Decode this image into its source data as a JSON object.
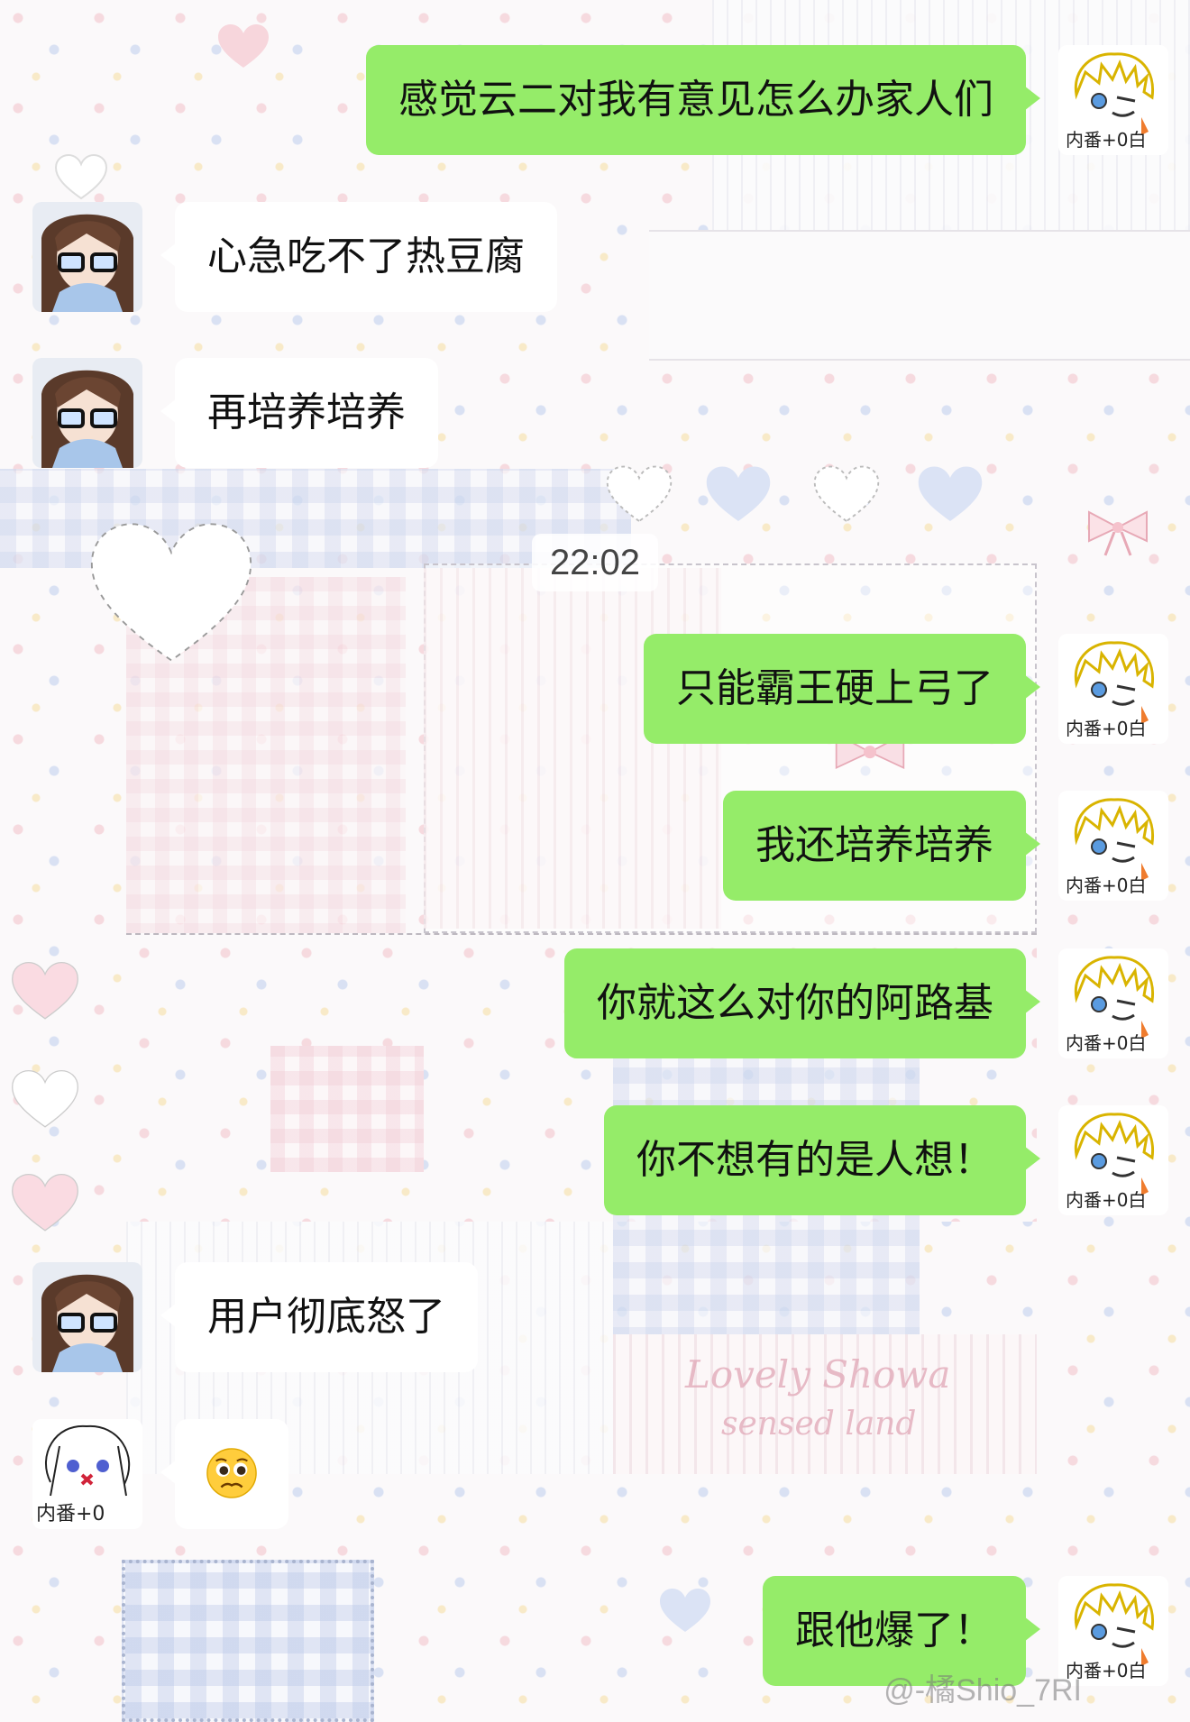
{
  "chat": {
    "timestamp": "22:02",
    "messages": [
      {
        "side": "out",
        "text": "感觉云二对我有意见怎么办家人们"
      },
      {
        "side": "in",
        "text": "心急吃不了热豆腐"
      },
      {
        "side": "in",
        "text": "再培养培养"
      },
      {
        "side": "out",
        "text": "只能霸王硬上弓了"
      },
      {
        "side": "out",
        "text": "我还培养培养"
      },
      {
        "side": "out",
        "text": "你就这么对你的阿路基"
      },
      {
        "side": "out",
        "text": "你不想有的是人想！"
      },
      {
        "side": "in",
        "text": "用户彻底怒了"
      },
      {
        "side": "in",
        "emoji": "pleading-face-icon"
      },
      {
        "side": "out",
        "text": "跟他爆了！"
      }
    ]
  },
  "wallpaper": {
    "text_1": "Lovely Showa",
    "text_2": "sensed land"
  },
  "avatars": {
    "self_label": "内番+0白",
    "other_b_label": "内番+0"
  },
  "watermark": "@-橘Shio_7RI",
  "colors": {
    "outgoing_bubble": "#95ec69",
    "incoming_bubble": "#ffffff",
    "background": "#f8f5f7"
  }
}
